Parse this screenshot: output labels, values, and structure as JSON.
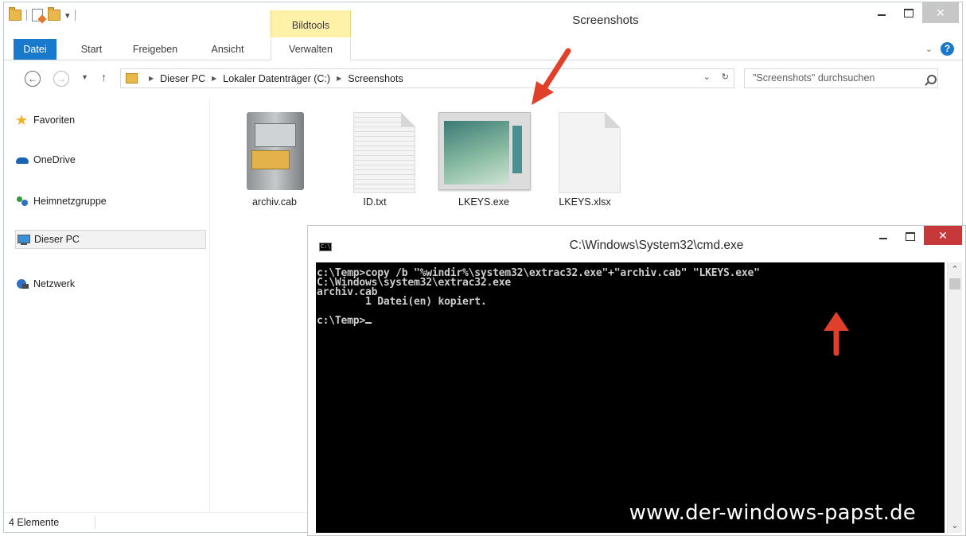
{
  "window": {
    "title": "Screenshots",
    "contextual_tab_group": "Bildtools"
  },
  "ribbon": {
    "tabs": [
      "Datei",
      "Start",
      "Freigeben",
      "Ansicht",
      "Verwalten"
    ]
  },
  "address": {
    "breadcrumb": [
      "Dieser PC",
      "Lokaler Datenträger (C:)",
      "Screenshots"
    ],
    "search_placeholder": "\"Screenshots\" durchsuchen"
  },
  "navpane": {
    "items": [
      {
        "label": "Favoriten",
        "icon": "star-icon"
      },
      {
        "label": "OneDrive",
        "icon": "onedrive-icon"
      },
      {
        "label": "Heimnetzgruppe",
        "icon": "homegroup-icon"
      },
      {
        "label": "Dieser PC",
        "icon": "pc-icon"
      },
      {
        "label": "Netzwerk",
        "icon": "network-icon"
      }
    ]
  },
  "files": [
    {
      "name": "archiv.cab",
      "icon": "cabinet-icon"
    },
    {
      "name": "ID.txt",
      "icon": "text-document-icon"
    },
    {
      "name": "LKEYS.exe",
      "icon": "exe-thumbnail"
    },
    {
      "name": "LKEYS.xlsx",
      "icon": "blank-document-icon"
    }
  ],
  "statusbar": {
    "item_count": "4 Elemente"
  },
  "cmd": {
    "title": "C:\\Windows\\System32\\cmd.exe",
    "icon_label": "C:\\.",
    "lines": [
      "c:\\Temp>copy /b \"%windir%\\system32\\extrac32.exe\"+\"archiv.cab\" \"LKEYS.exe\"",
      "C:\\Windows\\system32\\extrac32.exe",
      "archiv.cab",
      "        1 Datei(en) kopiert.",
      "",
      "c:\\Temp>"
    ],
    "watermark": "www.der-windows-papst.de"
  },
  "colors": {
    "accent": "#1979ca",
    "bildtools_highlight": "#fff2a8",
    "close_button": "#c7383a",
    "annotation_arrow": "#e0402a"
  }
}
